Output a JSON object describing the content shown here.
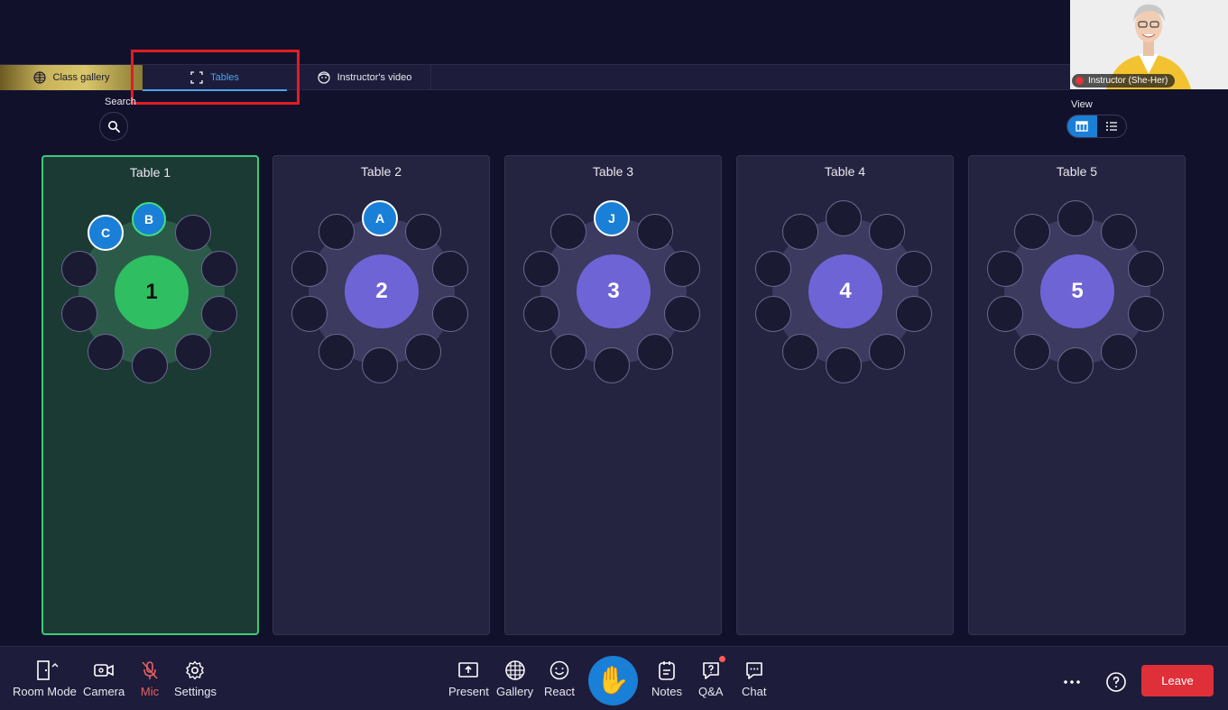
{
  "tabs": [
    {
      "label": "Class gallery",
      "icon": "globe-grid-icon"
    },
    {
      "label": "Tables",
      "icon": "focus-frame-icon",
      "active": true
    },
    {
      "label": "Instructor's video",
      "icon": "face-icon"
    }
  ],
  "instructor_video": {
    "label": "Instructor (She-Her)"
  },
  "search": {
    "label": "Search"
  },
  "view": {
    "label": "View",
    "options": [
      "table-grid-icon",
      "list-icon"
    ],
    "selected": "table-grid-icon"
  },
  "tables": [
    {
      "title": "Table 1",
      "number": "1",
      "active": true,
      "occupants": [
        "B",
        "C"
      ]
    },
    {
      "title": "Table 2",
      "number": "2",
      "active": false,
      "occupants": [
        "A"
      ]
    },
    {
      "title": "Table 3",
      "number": "3",
      "active": false,
      "occupants": [
        "J"
      ]
    },
    {
      "title": "Table 4",
      "number": "4",
      "active": false,
      "occupants": []
    },
    {
      "title": "Table 5",
      "number": "5",
      "active": false,
      "occupants": []
    }
  ],
  "toolbar": {
    "room_mode": "Room Mode",
    "camera": "Camera",
    "mic": "Mic",
    "settings": "Settings",
    "present": "Present",
    "gallery": "Gallery",
    "react": "React",
    "notes": "Notes",
    "qa": "Q&A",
    "chat": "Chat",
    "leave": "Leave"
  },
  "colors": {
    "background": "#12112b",
    "accent_blue": "#1a7fd6",
    "active_table": "#2fbf62",
    "table_center": "#6f64d6",
    "leave": "#df2f38",
    "highlight": "#e11d22"
  }
}
